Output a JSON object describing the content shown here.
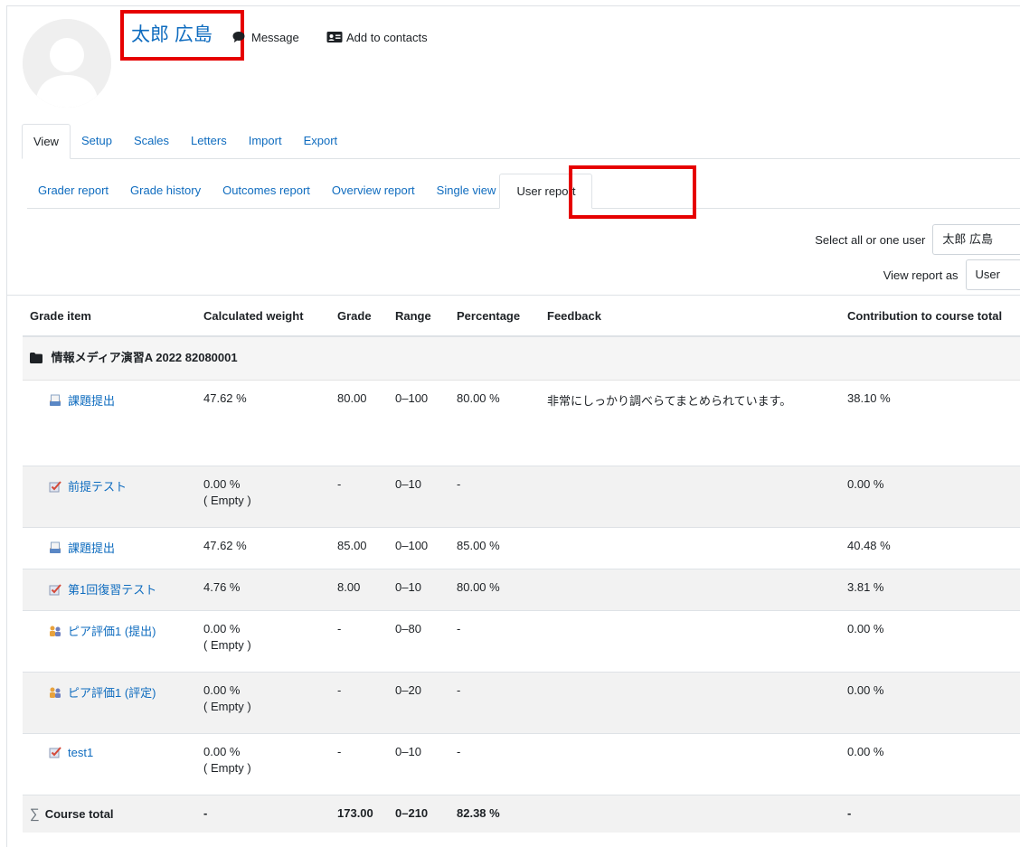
{
  "profile": {
    "name": "太郎 広島",
    "message_label": "Message",
    "add_contacts_label": "Add to contacts"
  },
  "tabs_primary": [
    {
      "label": "View",
      "active": true
    },
    {
      "label": "Setup"
    },
    {
      "label": "Scales"
    },
    {
      "label": "Letters"
    },
    {
      "label": "Import"
    },
    {
      "label": "Export"
    }
  ],
  "tabs_secondary": [
    {
      "label": "Grader report"
    },
    {
      "label": "Grade history"
    },
    {
      "label": "Outcomes report"
    },
    {
      "label": "Overview report"
    },
    {
      "label": "Single view"
    },
    {
      "label": "User report",
      "active": true
    }
  ],
  "selectors": {
    "user_label": "Select all or one user",
    "user_value": "太郎 広島",
    "view_as_label": "View report as",
    "view_as_value": "User"
  },
  "table": {
    "headers": {
      "item": "Grade item",
      "weight": "Calculated weight",
      "grade": "Grade",
      "range": "Range",
      "percentage": "Percentage",
      "feedback": "Feedback",
      "contribution": "Contribution to course total"
    },
    "category": "情報メディア演習A 2022 82080001",
    "rows": [
      {
        "name": "課題提出",
        "icon": "assignment-icon",
        "weight": "47.62 %",
        "empty": "",
        "grade": "80.00",
        "range": "0–100",
        "percentage": "80.00 %",
        "feedback": "非常にしっかり調べらてまとめられています。",
        "contribution": "38.10 %"
      },
      {
        "name": "前提テスト",
        "icon": "quiz-icon",
        "weight": "0.00 %",
        "empty": "( Empty )",
        "grade": "-",
        "range": "0–10",
        "percentage": "-",
        "feedback": "",
        "contribution": "0.00 %"
      },
      {
        "name": "課題提出",
        "icon": "assignment-icon",
        "weight": "47.62 %",
        "empty": "",
        "grade": "85.00",
        "range": "0–100",
        "percentage": "85.00 %",
        "feedback": "",
        "contribution": "40.48 %"
      },
      {
        "name": "第1回復習テスト",
        "icon": "quiz-icon",
        "weight": "4.76 %",
        "empty": "",
        "grade": "8.00",
        "range": "0–10",
        "percentage": "80.00 %",
        "feedback": "",
        "contribution": "3.81 %"
      },
      {
        "name": "ピア評価1 (提出)",
        "icon": "workshop-icon",
        "weight": "0.00 %",
        "empty": "( Empty )",
        "grade": "-",
        "range": "0–80",
        "percentage": "-",
        "feedback": "",
        "contribution": "0.00 %"
      },
      {
        "name": "ピア評価1 (評定)",
        "icon": "workshop-icon",
        "weight": "0.00 %",
        "empty": "( Empty )",
        "grade": "-",
        "range": "0–20",
        "percentage": "-",
        "feedback": "",
        "contribution": "0.00 %"
      },
      {
        "name": "test1",
        "icon": "quiz-icon",
        "weight": "0.00 %",
        "empty": "( Empty )",
        "grade": "-",
        "range": "0–10",
        "percentage": "-",
        "feedback": "",
        "contribution": "0.00 %"
      }
    ],
    "total": {
      "label": "Course total",
      "weight": "-",
      "grade": "173.00",
      "range": "0–210",
      "percentage": "82.38 %",
      "feedback": "",
      "contribution": "-"
    }
  },
  "colors": {
    "link": "#0f6cbf",
    "highlight": "#e60000",
    "row_alt": "#f2f2f2"
  }
}
